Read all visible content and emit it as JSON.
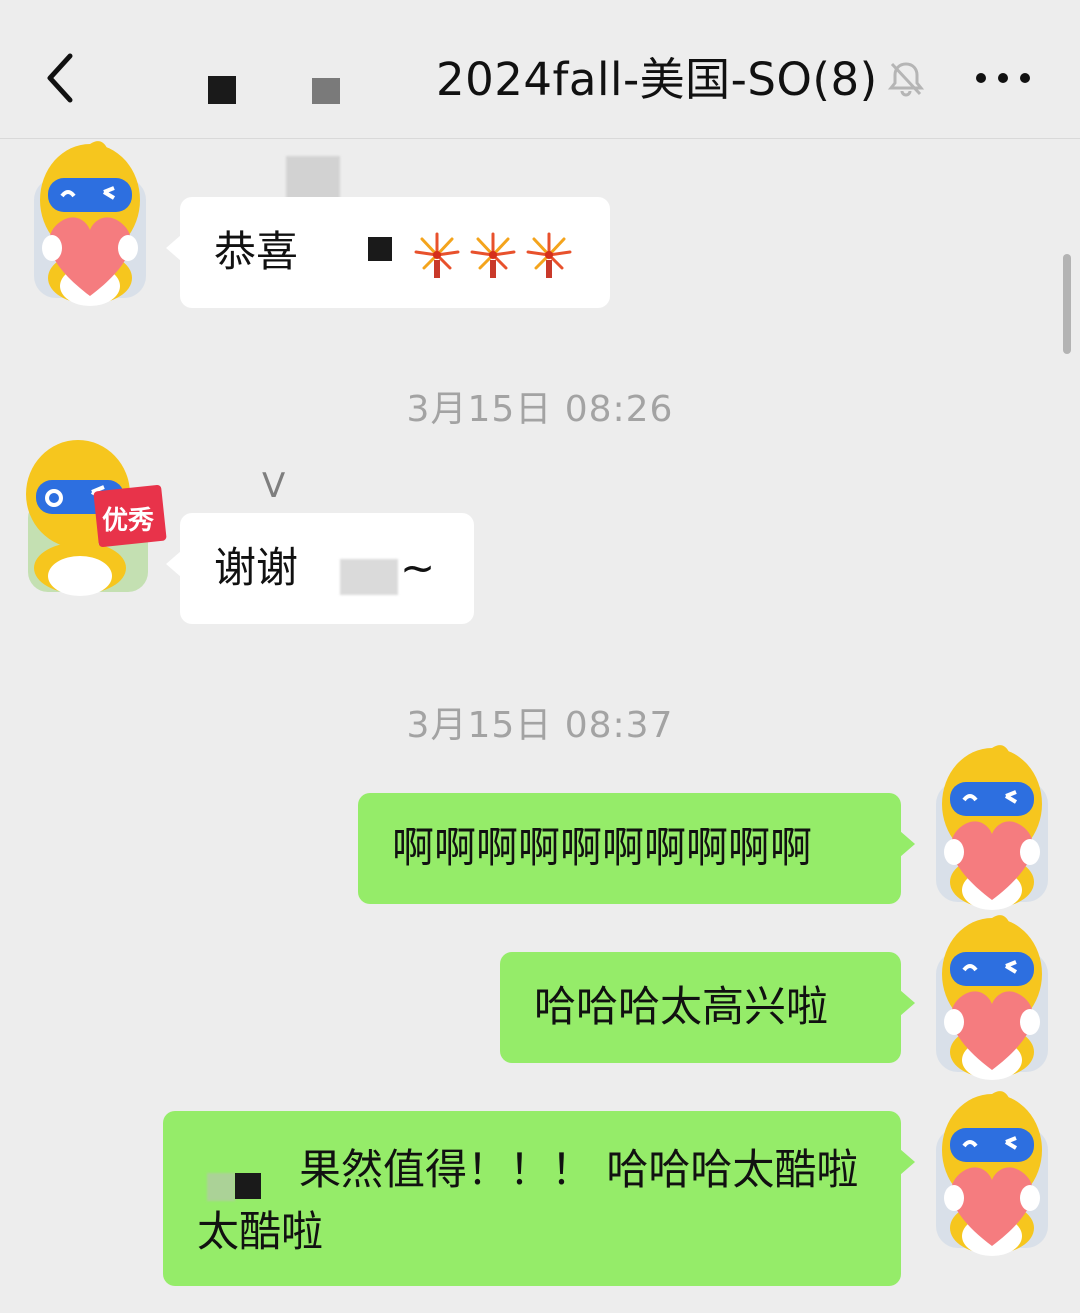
{
  "header": {
    "title": "2024fall-美国-SO(8)",
    "back_icon": "chevron-left-icon",
    "mute_icon": "bell-off-icon",
    "more_icon": "more-dots-icon"
  },
  "messages": [
    {
      "side": "in",
      "text": "恭喜",
      "emoji": "fireworks"
    },
    {
      "type": "time",
      "text": "3月15日 08:26"
    },
    {
      "side": "in",
      "sender": "V",
      "text_a": "谢谢",
      "text_b": "~"
    },
    {
      "type": "time",
      "text": "3月15日 08:37"
    },
    {
      "side": "out",
      "text": "啊啊啊啊啊啊啊啊啊啊"
    },
    {
      "side": "out",
      "text": "哈哈哈太高兴啦"
    },
    {
      "side": "out",
      "line1": "果然值得！！！ 哈哈哈太酷啦",
      "line2": "太酷啦"
    }
  ],
  "avatar_badge": "优秀",
  "colors": {
    "background": "#ededed",
    "bubble_out": "#95ec69",
    "bubble_in": "#ffffff",
    "timestamp": "#a3a3a3",
    "avatar_yellow": "#f6c61e",
    "avatar_heart": "#f57c7f"
  }
}
